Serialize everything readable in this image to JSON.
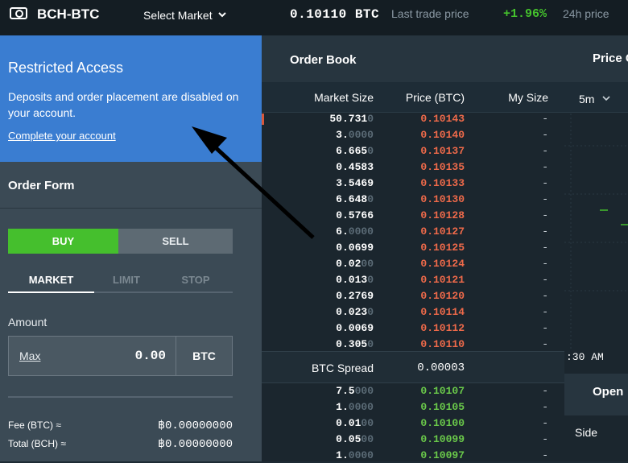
{
  "header": {
    "pair": "BCH-BTC",
    "select_market": "Select Market",
    "last_price": "0.10110 BTC",
    "last_price_label": "Last trade price",
    "change": "+1.96%",
    "change_label": "24h price"
  },
  "restricted": {
    "title": "Restricted Access",
    "message": "Deposits and order placement are disabled on your account.",
    "link": "Complete your account"
  },
  "order_form": {
    "title": "Order Form",
    "buy": "BUY",
    "sell": "SELL",
    "tabs": [
      "MARKET",
      "LIMIT",
      "STOP"
    ],
    "amount_label": "Amount",
    "max_label": "Max",
    "amount_value": "0.00",
    "currency": "BTC",
    "fee_label": "Fee (BTC) ≈",
    "fee_value": "฿0.00000000",
    "total_label": "Total (BCH) ≈",
    "total_value": "฿0.00000000"
  },
  "order_book": {
    "title": "Order Book",
    "col_size": "Market Size",
    "col_price": "Price (BTC)",
    "col_my": "My Size",
    "asks": [
      {
        "size": "50.731",
        "fade": "0",
        "price": "0.10143",
        "my": "-"
      },
      {
        "size": "3.",
        "fade": "0000",
        "price": "0.10140",
        "my": "-"
      },
      {
        "size": "6.665",
        "fade": "0",
        "price": "0.10137",
        "my": "-"
      },
      {
        "size": "0.4583",
        "fade": "",
        "price": "0.10135",
        "my": "-"
      },
      {
        "size": "3.5469",
        "fade": "",
        "price": "0.10133",
        "my": "-"
      },
      {
        "size": "6.648",
        "fade": "0",
        "price": "0.10130",
        "my": "-"
      },
      {
        "size": "0.5766",
        "fade": "",
        "price": "0.10128",
        "my": "-"
      },
      {
        "size": "6.",
        "fade": "0000",
        "price": "0.10127",
        "my": "-"
      },
      {
        "size": "0.0699",
        "fade": "",
        "price": "0.10125",
        "my": "-"
      },
      {
        "size": "0.02",
        "fade": "00",
        "price": "0.10124",
        "my": "-"
      },
      {
        "size": "0.013",
        "fade": "0",
        "price": "0.10121",
        "my": "-"
      },
      {
        "size": "0.2769",
        "fade": "",
        "price": "0.10120",
        "my": "-"
      },
      {
        "size": "0.023",
        "fade": "0",
        "price": "0.10114",
        "my": "-"
      },
      {
        "size": "0.0069",
        "fade": "",
        "price": "0.10112",
        "my": "-"
      },
      {
        "size": "0.305",
        "fade": "0",
        "price": "0.10110",
        "my": "-"
      }
    ],
    "spread_label": "BTC Spread",
    "spread_value": "0.00003",
    "bids": [
      {
        "size": "7.5",
        "fade": "000",
        "price": "0.10107",
        "my": "-"
      },
      {
        "size": "1.",
        "fade": "0000",
        "price": "0.10105",
        "my": "-"
      },
      {
        "size": "0.01",
        "fade": "00",
        "price": "0.10100",
        "my": "-"
      },
      {
        "size": "0.05",
        "fade": "00",
        "price": "0.10099",
        "my": "-"
      },
      {
        "size": "1.",
        "fade": "0000",
        "price": "0.10097",
        "my": "-"
      }
    ]
  },
  "chart_panel": {
    "title": "Price C",
    "interval": "5m",
    "time_label": ":30 AM",
    "open_title": "Open",
    "side_label": "Side"
  },
  "colors": {
    "accent_blue": "#3a7dd1",
    "buy_green": "#45bf2d",
    "ask_red": "#ef6a4a",
    "bid_green": "#6ac94a"
  }
}
